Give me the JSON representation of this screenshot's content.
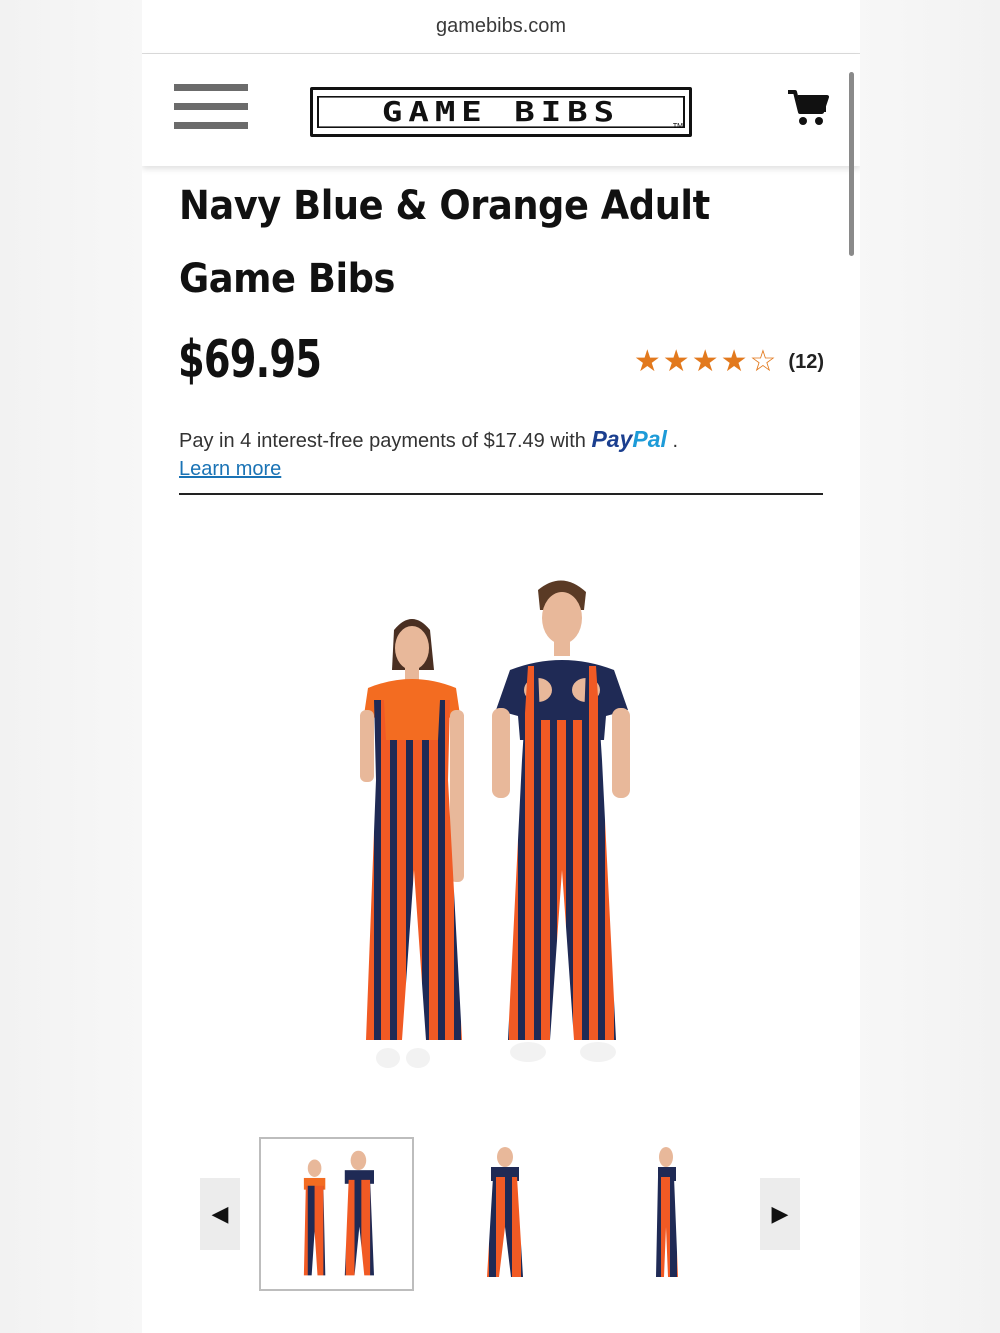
{
  "browser": {
    "url": "gamebibs.com"
  },
  "header": {
    "logo_text": "GAME BIBS",
    "logo_tm": "TM",
    "menu_icon": "hamburger-menu-icon",
    "cart_icon": "shopping-cart-icon"
  },
  "product": {
    "title": "Navy Blue & Orange Adult Game Bibs",
    "price": "$69.95",
    "rating": {
      "value": 4,
      "max": 5,
      "review_count": "(12)"
    },
    "paypal": {
      "text_before": "Pay in 4 interest-free payments of $17.49 with ",
      "brand_pay": "Pay",
      "brand_pal": "Pal",
      "text_after": " .",
      "learn_more": "Learn more"
    }
  },
  "gallery": {
    "prev_icon": "caret-left-icon",
    "next_icon": "caret-right-icon",
    "prev_glyph": "◀",
    "next_glyph": "▶",
    "selected_index": 0,
    "thumbnails": [
      "two-models-front",
      "female-model-front",
      "female-model-side"
    ]
  },
  "colors": {
    "orange": "#e2791d",
    "navy": "#1f2a55",
    "stripe_orange": "#f15a24",
    "paypal_dark": "#1b3f8f",
    "paypal_light": "#1d9bd8",
    "link": "#1a73b5"
  }
}
